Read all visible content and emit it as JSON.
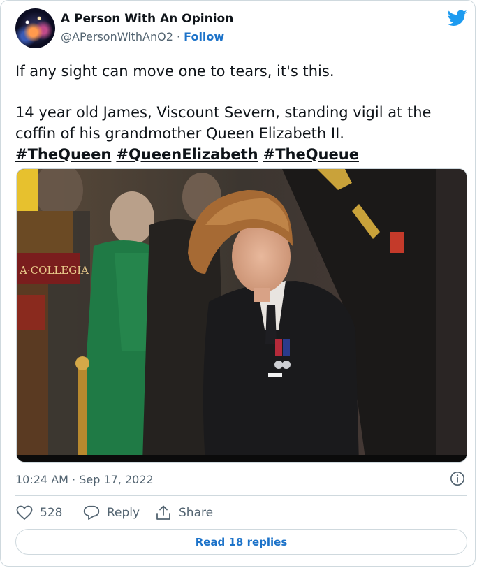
{
  "author": {
    "display_name": "A Person With An Opinion",
    "handle": "@APersonWithAnO2",
    "separator": " · ",
    "follow_label": "Follow"
  },
  "tweet": {
    "line1": "If any sight can move one to tears, it's this.",
    "line2": "14 year old James, Viscount Severn, standing vigil at the coffin of his grandmother Queen Elizabeth II.",
    "hashtags": [
      "#TheQueen",
      "#QueenElizabeth",
      "#TheQueue"
    ],
    "image_overlay_text": "A·COLLEGIA"
  },
  "meta": {
    "timestamp": "10:24 AM · Sep 17, 2022"
  },
  "actions": {
    "like_count": "528",
    "reply_label": "Reply",
    "share_label": "Share",
    "read_replies_label": "Read 18 replies"
  },
  "icons": {
    "brand": "twitter-bird-icon",
    "info": "info-icon",
    "like": "heart-icon",
    "reply": "speech-bubble-icon",
    "share": "share-arrow-icon"
  },
  "colors": {
    "link_blue": "#1d73c9",
    "twitter_blue": "#1d9bf0",
    "secondary_text": "#536471",
    "border": "#cfd9de"
  }
}
